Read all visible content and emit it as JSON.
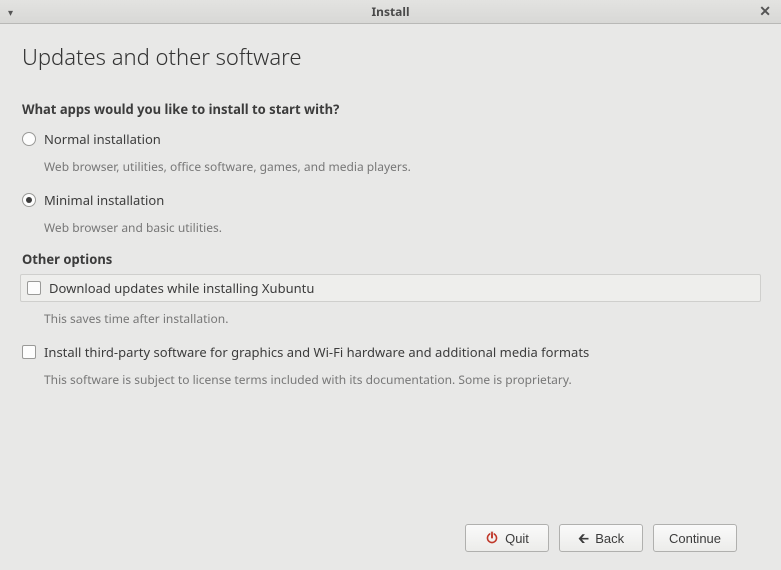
{
  "titlebar": {
    "title": "Install"
  },
  "page": {
    "heading": "Updates and other software",
    "question": "What apps would you like to install to start with?",
    "options": {
      "normal": {
        "label": "Normal installation",
        "desc": "Web browser, utilities, office software, games, and media players."
      },
      "minimal": {
        "label": "Minimal installation",
        "desc": "Web browser and basic utilities."
      }
    },
    "other_options_label": "Other options",
    "download_updates": {
      "label": "Download updates while installing Xubuntu",
      "desc": "This saves time after installation."
    },
    "third_party": {
      "label": "Install third-party software for graphics and Wi-Fi hardware and additional media formats",
      "desc": "This software is subject to license terms included with its documentation. Some is proprietary."
    }
  },
  "buttons": {
    "quit": "Quit",
    "back": "Back",
    "continue": "Continue"
  }
}
